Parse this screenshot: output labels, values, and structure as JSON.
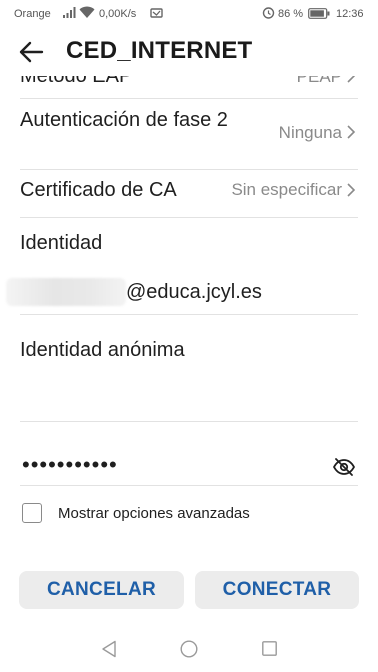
{
  "status_bar": {
    "carrier": "Orange",
    "speed": "0,00K/s",
    "battery_percent": "86 %",
    "time": "12:36",
    "icons": [
      "signal-icon",
      "wifi-icon",
      "notification-icon",
      "alarm-icon",
      "battery-icon"
    ]
  },
  "app_bar": {
    "title": "CED_INTERNET",
    "back_icon": "back-arrow-icon"
  },
  "form": {
    "eap_method": {
      "label": "Método EAP",
      "value": "PEAP"
    },
    "phase2_auth": {
      "label": "Autenticación de fase 2",
      "value": "Ninguna"
    },
    "ca_certificate": {
      "label": "Certificado de CA",
      "value": "Sin especificar"
    },
    "identity": {
      "label": "Identidad",
      "value_suffix": "@educa.jcyl.es"
    },
    "anonymous_identity": {
      "label": "Identidad anónima",
      "value": ""
    },
    "password": {
      "masked_value": "•••••••••••",
      "toggle_icon": "eye-off-icon"
    },
    "advanced_options": {
      "label": "Mostrar opciones avanzadas",
      "checked": false
    }
  },
  "buttons": {
    "cancel": "CANCELAR",
    "connect": "CONECTAR"
  },
  "colors": {
    "accent": "#1f5fa8",
    "button_bg": "#ececec",
    "secondary_text": "#8a8a8a",
    "divider": "#e2e2e2"
  }
}
